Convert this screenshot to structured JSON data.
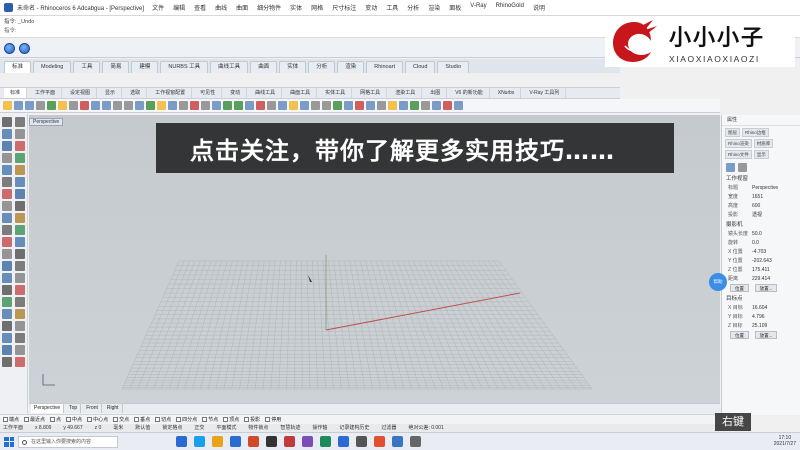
{
  "window": {
    "title": "未命名 - Rhinoceros 6 Adcabgua - [Perspective]",
    "menus": [
      "文件",
      "编辑",
      "查看",
      "曲线",
      "曲面",
      "细分物件",
      "实体",
      "网格",
      "尺寸标注",
      "变动",
      "工具",
      "分析",
      "渲染",
      "面板",
      "V-Ray",
      "RhinoGold",
      "说明"
    ]
  },
  "command": {
    "line1": "指令: _Undo",
    "line2": "指令:"
  },
  "tabs_top": [
    "标准",
    "Modeling",
    "工具",
    "简易",
    "建模",
    "NURBS 工具",
    "曲线工具",
    "曲面",
    "实体",
    "分析",
    "渲染",
    "Rhinoart",
    "Cloud",
    "Studio"
  ],
  "tabs_second": [
    "标准",
    "工作平面",
    "设定视图",
    "显示",
    "选取",
    "工作视窗配置",
    "可见性",
    "变动",
    "曲线工具",
    "曲面工具",
    "实体工具",
    "网格工具",
    "渲染工具",
    "出图",
    "V6 的新功能",
    "XNurbs",
    "V-Ray 工具列"
  ],
  "viewport": {
    "label": "Perspective",
    "tabs": [
      "Perspective",
      "Top",
      "Front",
      "Right"
    ]
  },
  "banner": {
    "text": "点击关注，带你了解更多实用技巧……"
  },
  "logo": {
    "cn": "小小小子",
    "en": "XIAOXIAOXIAOZI",
    "colors": {
      "dragon": "#c8161d",
      "text": "#111111"
    }
  },
  "right_panel": {
    "tab_label": "属性",
    "chips": [
      "图层",
      "Rhino边框",
      "Rhino渲染",
      "材质库",
      "Rhino文件",
      "显示"
    ],
    "section_view": "工作视窗",
    "view_rows": [
      {
        "k": "标题",
        "v": "Perspective"
      },
      {
        "k": "宽度",
        "v": "1651"
      },
      {
        "k": "高度",
        "v": "600"
      },
      {
        "k": "投影",
        "v": "透视"
      }
    ],
    "section_camera": "摄影机",
    "camera_rows": [
      {
        "k": "镜头长度",
        "v": "50.0"
      },
      {
        "k": "旋转",
        "v": "0.0"
      },
      {
        "k": "X 位置",
        "v": "-4.703"
      },
      {
        "k": "Y 位置",
        "v": "-202.643"
      },
      {
        "k": "Z 位置",
        "v": "175.411"
      },
      {
        "k": "距离",
        "v": "229.414"
      }
    ],
    "camera_btn1": "位置",
    "camera_btn2": "放置...",
    "section_target": "目标点",
    "target_rows": [
      {
        "k": "X 目标",
        "v": "16.604"
      },
      {
        "k": "Y 目标",
        "v": "4.796"
      },
      {
        "k": "Z 目标",
        "v": "25.109"
      }
    ],
    "target_btn1": "位置",
    "target_btn2": "放置...",
    "bubble": "帮助"
  },
  "osnap": [
    "端点",
    "最近点",
    "点",
    "中点",
    "中心点",
    "交点",
    "垂点",
    "切点",
    "四分点",
    "节点",
    "顶点",
    "投影",
    "停用"
  ],
  "status": {
    "cplane": "工作平面",
    "x": "x 8.809",
    "y": "y 49.667",
    "z": "z 0",
    "units": "毫米",
    "layer": "默认值",
    "grid_snap": "锁定格点",
    "ortho": "正交",
    "planar": "平面模式",
    "osnap": "物件锁点",
    "smarttrack": "智慧轨迹",
    "gumball": "操作轴",
    "history": "记录建构历史",
    "filter": "过滤器",
    "tolerance": "绝对公差: 0.001"
  },
  "taskbar": {
    "search_placeholder": "在这里输入你要搜索的内容",
    "time": "17:10",
    "date": "2021/7/27"
  },
  "corner_button": "右键"
}
